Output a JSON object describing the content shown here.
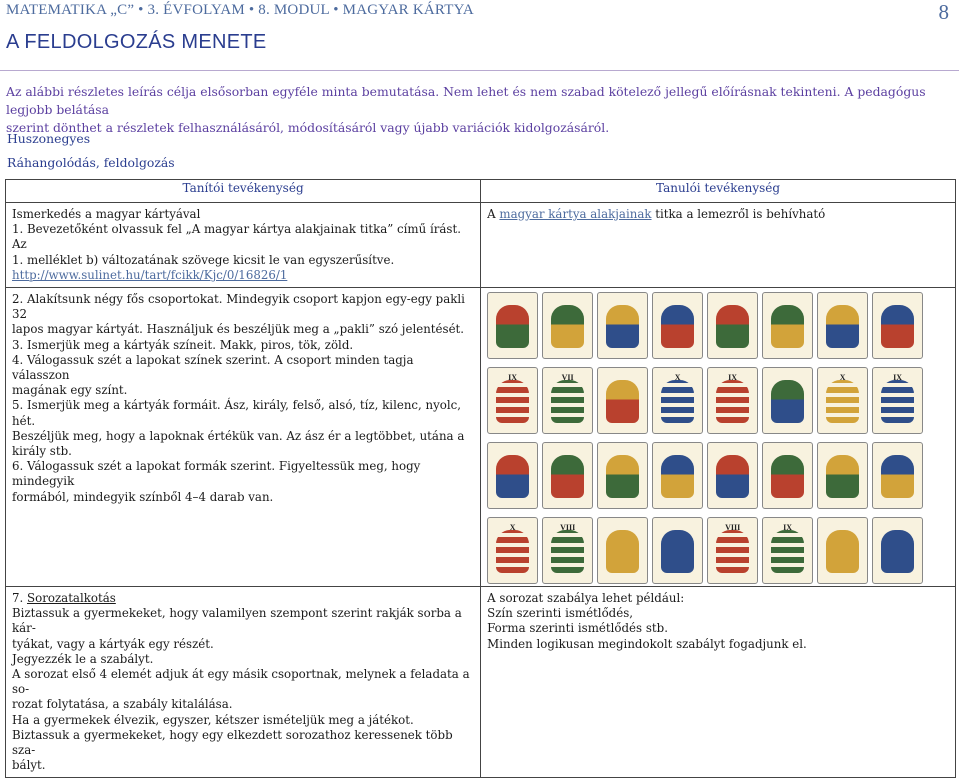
{
  "header": {
    "running_title": "MATEMATIKA „C” • 3. ÉVFOLYAM • 8. MODUL • MAGYAR KÁRTYA",
    "page_number": "8"
  },
  "section_title": "A FELDOLGOZÁS MENETE",
  "intro": {
    "text1": "Az alábbi részletes leírás célja elsősorban egyféle minta bemutatása. Nem lehet és nem szabad kötelező jellegű előírásnak tekinteni. A pedagógus legjobb belátása",
    "text2": "szerint dönthet a részletek felhasználásáról, módosításáról vagy újabb variációk kidolgozásáról."
  },
  "game_title": "Huszonegyes",
  "phase_title": "Ráhangolódás, feldolgozás",
  "table": {
    "col1_header": "Tanítói tevékenység",
    "col2_header": "Tanulói tevékenység",
    "row1": {
      "heading": "Ismerkedés a magyar kártyával",
      "line1": "1. Bevezetőként olvassuk fel „A magyar kártya alakjainak titka” című írást. Az",
      "line2": "1. melléklet b) változatának szövege kicsit le van egyszerűsítve.",
      "link": "http://www.sulinet.hu/tart/fcikk/Kjc/0/16826/1",
      "student_pre": "A ",
      "student_link": "magyar kártya alakjainak",
      "student_post": " titka a lemezről is behívható"
    },
    "row2": {
      "l1": "2. Alakítsunk négy fős csoportokat. Mindegyik csoport kapjon egy-egy pakli 32",
      "l2": "lapos magyar kártyát. Használjuk és beszéljük meg a „pakli” szó jelentését.",
      "l3": "3. Ismerjük meg a kártyák színeit. Makk, piros, tök, zöld.",
      "l4": "4. Válogassuk szét a lapokat színek szerint. A csoport minden tagja válasszon",
      "l5": "magának egy színt.",
      "l6": "5. Ismerjük meg a kártyák formáit. Ász, király, felső, alsó, tíz, kilenc, nyolc, hét.",
      "l7": "Beszéljük meg, hogy a lapoknak értékük van. Az ász ér a legtöbbet, utána a",
      "l8": "király stb.",
      "l9": "6. Válogassuk szét a lapokat formák szerint. Figyeltessük meg, hogy mindegyik",
      "l10": "formából, mindegyik színből 4–4 darab van.",
      "cards": [
        "",
        "",
        "",
        "",
        "",
        "",
        "",
        "",
        "IX",
        "VII",
        "",
        "X",
        "IX",
        "",
        "X",
        "IX",
        "",
        "",
        "",
        "",
        "",
        "",
        "",
        "",
        "X",
        "VIII",
        "",
        "",
        "VIII",
        "IX",
        "",
        ""
      ]
    },
    "row3": {
      "num": "7. ",
      "title": "Sorozatalkotás",
      "l1": "Biztassuk a gyermekeket, hogy valamilyen szempont szerint rakják sorba a kár-",
      "l2": "tyákat, vagy a kártyák egy részét.",
      "l3": "Jegyezzék le a szabályt.",
      "l4": "A sorozat első 4 elemét adjuk át egy másik csoportnak, melynek a feladata a so-",
      "l5": "rozat folytatása, a szabály kitalálása.",
      "l6": "Ha a gyermekek élvezik, egyszer, kétszer ismételjük meg a játékot.",
      "l7": "Biztassuk a gyermekeket, hogy egy elkezdett sorozathoz keressenek több sza-",
      "l8": "bályt.",
      "s1": "A sorozat szabálya lehet például:",
      "s2": "Szín szerinti ismétlődés,",
      "s3": "Forma szerinti ismétlődés stb.",
      "s4": "Minden logikusan megindokolt szabályt fogadjunk el."
    }
  },
  "colors": {
    "header_blue": "#4d6b9e",
    "title_blue": "#2a3d8f",
    "intro_purple": "#5b3fa0"
  }
}
